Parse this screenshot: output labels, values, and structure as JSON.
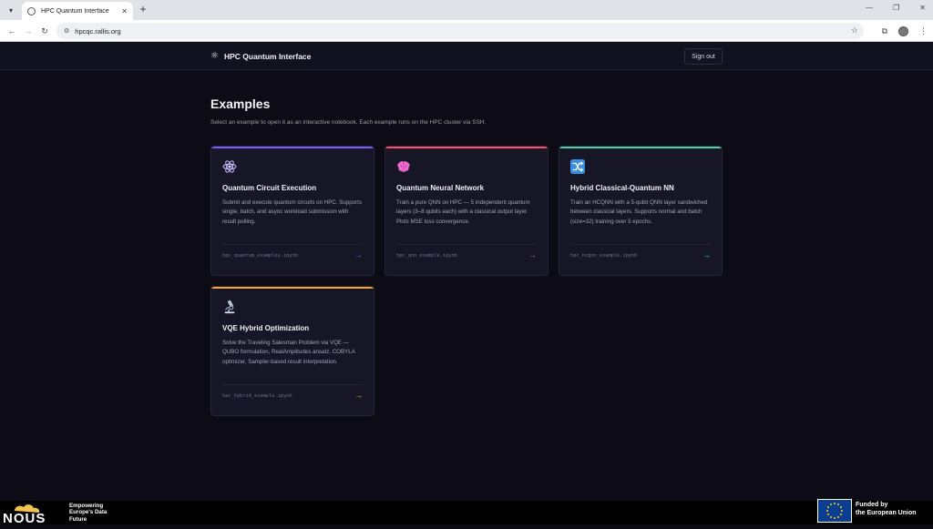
{
  "browser": {
    "tab_title": "HPC Quantum Interface",
    "url": "hpcqc.rallis.org"
  },
  "app": {
    "name": "HPC Quantum Interface",
    "sign_out": "Sign out"
  },
  "main": {
    "heading": "Examples",
    "subtitle": "Select an example to open it as an interactive notebook. Each example runs on the HPC cluster via SSH."
  },
  "cards": [
    {
      "title": "Quantum Circuit Execution",
      "description": "Submit and execute quantum circuits on HPC. Supports single, batch, and async workload submission with result polling.",
      "file": "hpc_quantum_examples.ipynb",
      "arrow": "→",
      "icon": "atom-icon",
      "accent": "#7c5cff"
    },
    {
      "title": "Quantum Neural Network",
      "description": "Train a pure QNN on HPC — 5 independent quantum layers (3–8 qubits each) with a classical output layer. Plots MSE loss convergence.",
      "file": "hpc_qnn_example.ipynb",
      "arrow": "→",
      "icon": "brain-icon",
      "accent": "#ff4d6d"
    },
    {
      "title": "Hybrid Classical-Quantum NN",
      "description": "Train an HCQNN with a 5-qubit QNN layer sandwiched between classical layers. Supports normal and batch (size=32) training over 5 epochs.",
      "file": "hpc_hcqnn_example.ipynb",
      "arrow": "→",
      "icon": "shuffle-icon",
      "accent": "#4fd1a5"
    },
    {
      "title": "VQE Hybrid Optimization",
      "description": "Solve the Traveling Salesman Problem via VQE — QUBO formulation, RealAmplitudes ansatz, COBYLA optimizer, Sampler-based result interpretation.",
      "file": "hpc_hybrid_example.ipynb",
      "arrow": "→",
      "icon": "microscope-icon",
      "accent": "#f5a623"
    }
  ],
  "footer": {
    "logo_text": "NOUS",
    "tagline_1": "Empowering",
    "tagline_2": "Europe's Data",
    "tagline_3": "Future",
    "eu_1": "Funded by",
    "eu_2": "the European Union"
  }
}
